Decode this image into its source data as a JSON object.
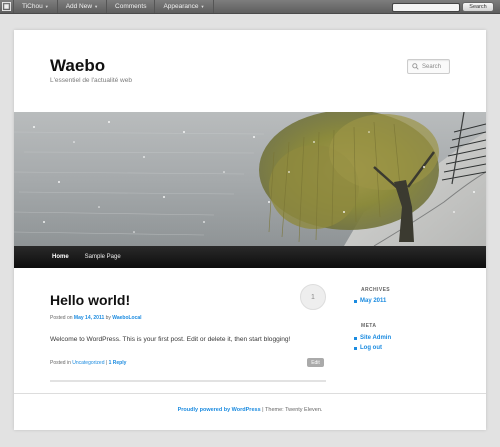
{
  "adminbar": {
    "items": [
      {
        "label": "TiChou",
        "dropdown": true
      },
      {
        "label": "Add New",
        "dropdown": true
      },
      {
        "label": "Comments",
        "dropdown": false
      },
      {
        "label": "Appearance",
        "dropdown": true
      }
    ],
    "search_button": "Search"
  },
  "site": {
    "title": "Waebo",
    "description": "L'essentiel de l'actualité web",
    "search_placeholder": "Search"
  },
  "nav": {
    "items": [
      "Home",
      "Sample Page"
    ]
  },
  "post": {
    "title": "Hello world!",
    "comment_count": "1",
    "meta_prefix": "Posted on",
    "date": "May 14, 2011",
    "meta_by": "by",
    "author": "WaeboLocal",
    "content": "Welcome to WordPress. This is your first post. Edit or delete it, then start blogging!",
    "footer_prefix": "Posted in",
    "category": "Uncategorized",
    "separator": "|",
    "replies": "1 Reply",
    "edit_label": "Edit"
  },
  "sidebar": {
    "archives_title": "ARCHIVES",
    "archives": [
      "May 2011"
    ],
    "meta_title": "META",
    "meta": [
      "Site Admin",
      "Log out"
    ]
  },
  "footer": {
    "powered": "Proudly powered by WordPress",
    "separator": "|",
    "theme": "Theme: Twenty Eleven."
  },
  "colors": {
    "link": "#1b8be0",
    "admin_bar": "#6a6a6a",
    "nav": "#1a1a1a"
  }
}
